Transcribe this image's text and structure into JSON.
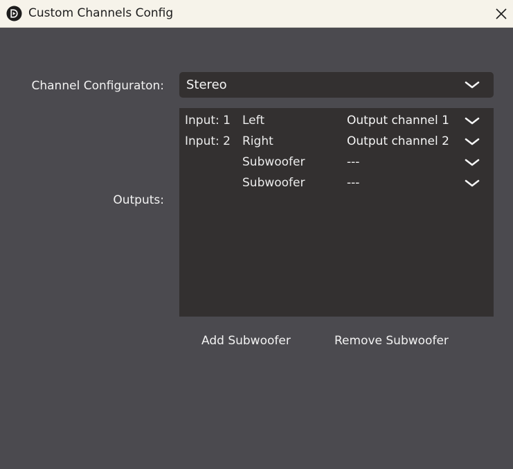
{
  "window": {
    "title": "Custom Channels Config",
    "app_icon": "audio-app-logo-icon",
    "close_icon": "close-icon"
  },
  "config": {
    "label": "Channel Configuraton:",
    "value": "Stereo"
  },
  "outputs": {
    "label": "Outputs:",
    "rows": [
      {
        "input": "Input: 1",
        "channel": "Left",
        "output": "Output channel 1"
      },
      {
        "input": "Input: 2",
        "channel": "Right",
        "output": "Output channel 2"
      },
      {
        "input": "",
        "channel": "Subwoofer",
        "output": "---"
      },
      {
        "input": "",
        "channel": "Subwoofer",
        "output": "---"
      }
    ]
  },
  "buttons": {
    "add": "Add Subwoofer",
    "remove": "Remove Subwoofer"
  },
  "colors": {
    "background": "#4b4a4f",
    "panel": "#333030",
    "titlebar": "#f6f3ea",
    "text": "#f2f2f2"
  }
}
